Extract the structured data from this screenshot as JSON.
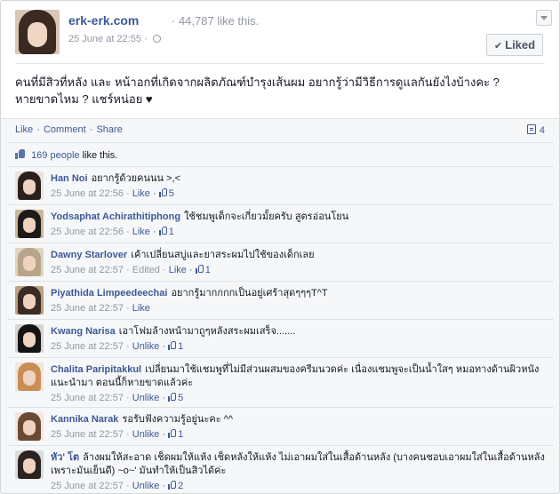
{
  "post": {
    "page_name": "erk-erk.com",
    "page_likes": "· 44,787 like this.",
    "timestamp": "25 June at 22:55 ·",
    "liked_label": "Liked",
    "text": "คนที่มีสิวที่หลัง และ หน้าอกที่เกิดจากผลิตภัณฑ์บำรุงเส้นผม อยากรู้ว่ามีวิธีการดูแลกันยังไงบ้างคะ ? หายขาดไหม ? แชร์หน่อย ♥"
  },
  "actions": {
    "like": "Like",
    "comment": "Comment",
    "share": "Share",
    "separator": "·",
    "comment_count": "4"
  },
  "likes_summary": {
    "count_link": "169 people",
    "suffix": "like this."
  },
  "comments": [
    {
      "name": "Han Noi",
      "text": "อยากรู้ด้วยคนนน >,<",
      "time": "25 June at 22:56 ·",
      "action": "Like",
      "likes": "5",
      "avatar_hair": "#2b201c",
      "avatar_bg": "#e9e4df"
    },
    {
      "name": "Yodsaphat Achirathitiphong",
      "text": "ใช้ชมพูเด็กจะเกี่ยวมั้ยครับ สูตรอ่อนโยน",
      "time": "25 June at 22:56 ·",
      "action": "Like",
      "likes": "1",
      "avatar_hair": "#1e1a18",
      "avatar_bg": "#c9b79c"
    },
    {
      "name": "Dawny Starlover",
      "text": "เค้าเปลี่ยนสบู่และยาสระผมไปใช้ของเด็กเลย",
      "time": "25 June at 22:57 · Edited ·",
      "action": "Like",
      "likes": "1",
      "avatar_hair": "#b7a489",
      "avatar_bg": "#ddd4c4"
    },
    {
      "name": "Piyathida Limpeedeechai",
      "text": "อยากรู้มากกกกเป็นอยู่เศร้าสุดๆๆๆT^T",
      "time": "25 June at 22:57 ·",
      "action": "Like",
      "likes": "",
      "avatar_hair": "#3b2c23",
      "avatar_bg": "#bba283"
    },
    {
      "name": "Kwang Narisa",
      "text": "เอาโฟมล้างหน้ามาถูๆหลังสระผมเสร็จ.......",
      "time": "25 June at 22:57 ·",
      "action": "Unlike",
      "likes": "1",
      "avatar_hair": "#141414",
      "avatar_bg": "#d8d3cf"
    },
    {
      "name": "Chalita Paripitakkul",
      "text": "เปลี่ยนมาใช้แชมพูที่ไม่มีส่วนผสมของครีมนวดค่ะ เนื่องแชมพูจะเป็นน้ำใสๆ หมอทางด้านผิวหนังแนะนำมา ตอนนี้ก็หายขาดแล้วค่ะ",
      "time": "25 June at 22:57 ·",
      "action": "Unlike",
      "likes": "5",
      "avatar_hair": "#c98e56",
      "avatar_bg": "#efe7da"
    },
    {
      "name": "Kannika Narak",
      "text": "รอรับฟังความรู้อยู่นะคะ ^^",
      "time": "25 June at 22:57 ·",
      "action": "Unlike",
      "likes": "1",
      "avatar_hair": "#6b4a35",
      "avatar_bg": "#f1e6de"
    },
    {
      "name": "หัว' โต",
      "text": "ล้างผมให้สะอาด เช็ดผมให้แห้ง เช็ดหลังให้แห้ง ไม่เอาผมใส่ในเสื้อด้านหลัง (บางคนชอบเอาผมใส่ในเสื้อด้านหลังเพราะมันเย็นดี) ~o~' มันทำให้เป็นสิวได้ค่ะ",
      "time": "25 June at 22:57 ·",
      "action": "Unlike",
      "likes": "2",
      "avatar_hair": "#2a2320",
      "avatar_bg": "#dcdcdc"
    }
  ]
}
